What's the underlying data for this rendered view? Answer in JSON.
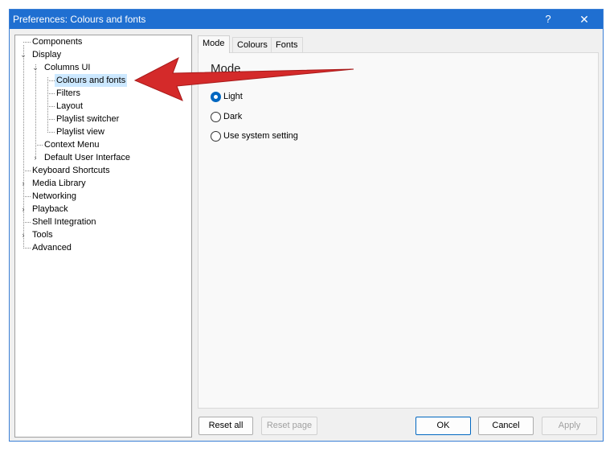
{
  "window": {
    "title": "Preferences: Colours and fonts",
    "help_label": "?",
    "close_label": "✕"
  },
  "tree": {
    "items": [
      {
        "label": "Components"
      },
      {
        "label": "Display"
      },
      {
        "label": "Columns UI"
      },
      {
        "label": "Colours and fonts",
        "selected": true
      },
      {
        "label": "Filters"
      },
      {
        "label": "Layout"
      },
      {
        "label": "Playlist switcher"
      },
      {
        "label": "Playlist view"
      },
      {
        "label": "Context Menu"
      },
      {
        "label": "Default User Interface"
      },
      {
        "label": "Keyboard Shortcuts"
      },
      {
        "label": "Media Library"
      },
      {
        "label": "Networking"
      },
      {
        "label": "Playback"
      },
      {
        "label": "Shell Integration"
      },
      {
        "label": "Tools"
      },
      {
        "label": "Advanced"
      }
    ]
  },
  "tabs": [
    {
      "label": "Mode",
      "active": true
    },
    {
      "label": "Colours"
    },
    {
      "label": "Fonts"
    }
  ],
  "mode_panel": {
    "heading": "Mode",
    "options": [
      {
        "label": "Light",
        "checked": true
      },
      {
        "label": "Dark"
      },
      {
        "label": "Use system setting"
      }
    ]
  },
  "buttons": {
    "reset_all": "Reset all",
    "reset_page": "Reset page",
    "ok": "OK",
    "cancel": "Cancel",
    "apply": "Apply"
  },
  "colors": {
    "titlebar": "#1f6fd1",
    "selection": "#cce8ff",
    "annotation_arrow": "#d42a2a"
  }
}
